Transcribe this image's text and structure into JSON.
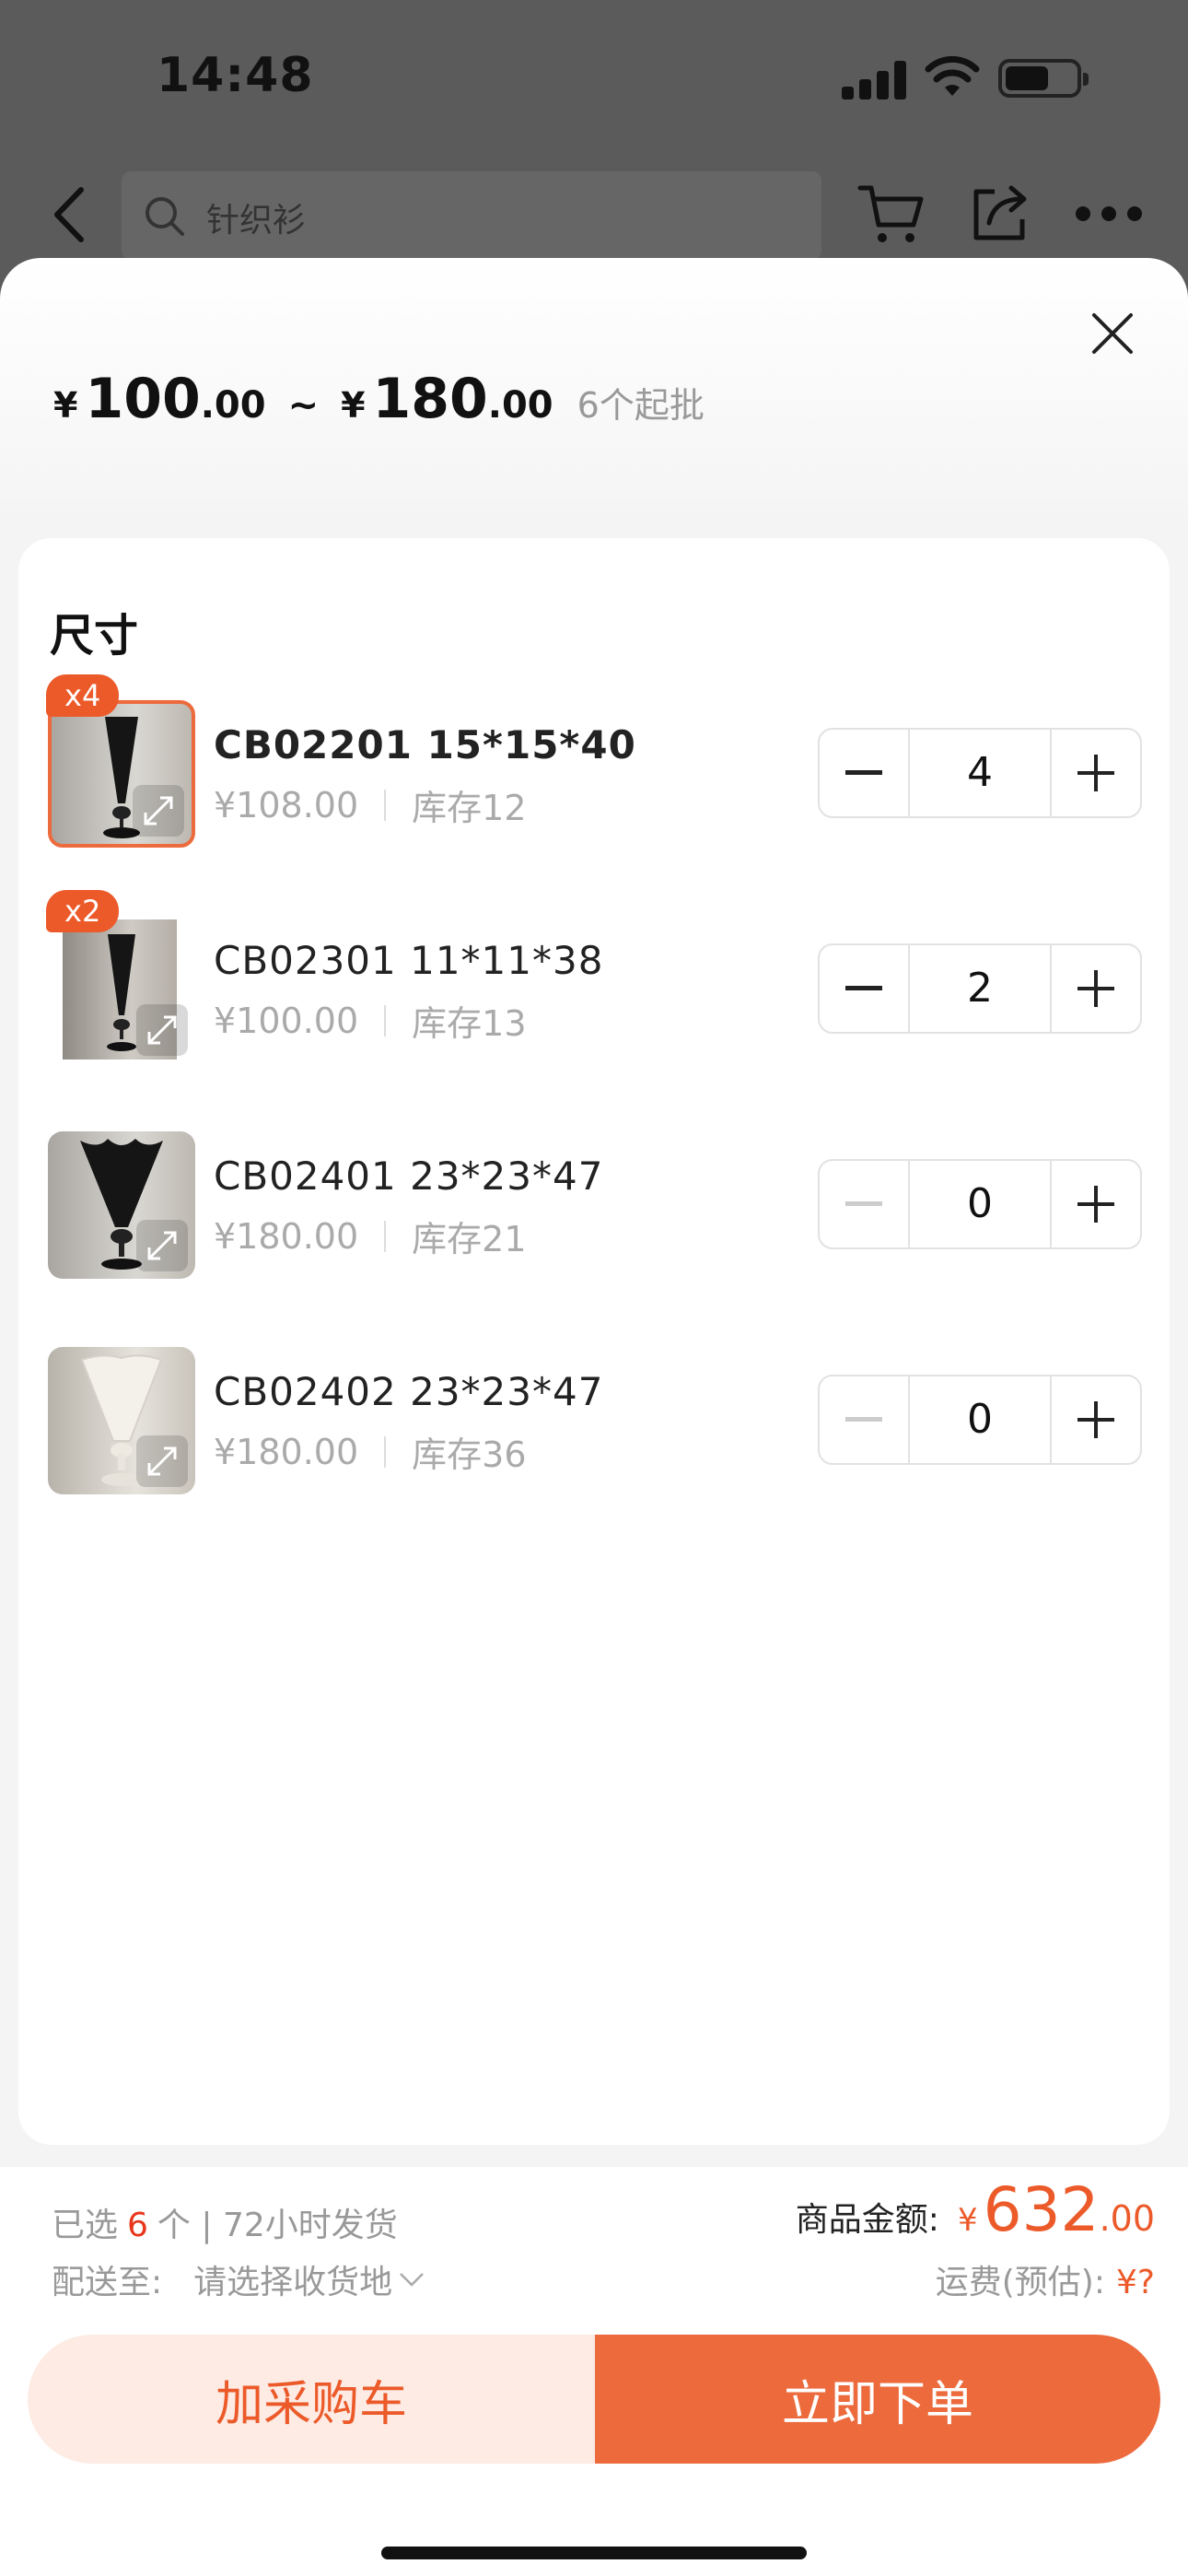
{
  "status_bar": {
    "time": "14:48"
  },
  "nav": {
    "search_placeholder": "针织衫"
  },
  "sheet": {
    "price_min": {
      "currency": "¥",
      "int": "100",
      "dec": ".00"
    },
    "price_sep": "~",
    "price_max": {
      "currency": "¥",
      "int": "180",
      "dec": ".00"
    },
    "moq": "6个起批",
    "section_title": "尺寸",
    "items": [
      {
        "badge": "x4",
        "name": "CB02201  15*15*40",
        "price": "¥108.00",
        "stock": "库存12",
        "qty": "4",
        "selected": true
      },
      {
        "badge": "x2",
        "name": "CB02301  11*11*38",
        "price": "¥100.00",
        "stock": "库存13",
        "qty": "2",
        "selected": true
      },
      {
        "badge": "",
        "name": "CB02401  23*23*47",
        "price": "¥180.00",
        "stock": "库存21",
        "qty": "0",
        "selected": false
      },
      {
        "badge": "",
        "name": "CB02402  23*23*47",
        "price": "¥180.00",
        "stock": "库存36",
        "qty": "0",
        "selected": false
      }
    ]
  },
  "footer": {
    "selected_prefix": "已选",
    "selected_count": "6",
    "selected_suffix": "个 | 72小时发货",
    "ship_label": "配送至:",
    "ship_value": "请选择收货地",
    "amount_label": "商品金额:",
    "amount_currency": "¥",
    "amount_int": "632",
    "amount_dec": ".00",
    "freight_label": "运费(预估):",
    "freight_value": "¥?",
    "add_cart": "加采购车",
    "buy_now": "立即下单"
  },
  "colors": {
    "accent": "#ec6a3c",
    "accent_light": "#fdebe4",
    "badge": "#ec5a2a",
    "count_red": "#e8361b"
  }
}
